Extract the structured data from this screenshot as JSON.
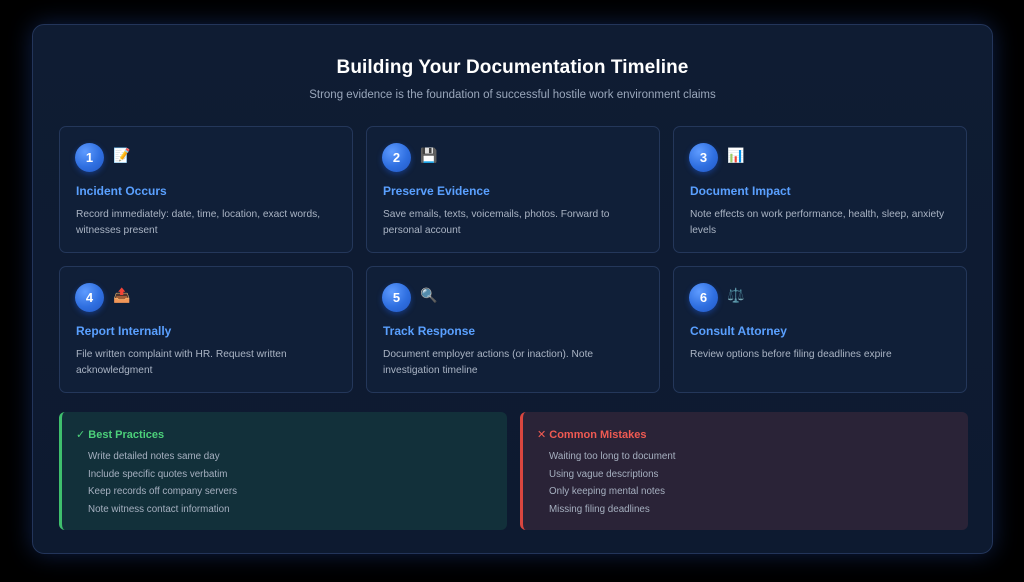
{
  "header": {
    "title": "Building Your Documentation Timeline",
    "subtitle": "Strong evidence is the foundation of successful hostile work environment claims"
  },
  "steps": [
    {
      "number": "1",
      "icon": "memo-icon",
      "glyph": "📝",
      "title": "Incident Occurs",
      "description": "Record immediately: date, time, location, exact words, witnesses present"
    },
    {
      "number": "2",
      "icon": "floppy-disk-icon",
      "glyph": "💾",
      "title": "Preserve Evidence",
      "description": "Save emails, texts, voicemails, photos. Forward to personal account"
    },
    {
      "number": "3",
      "icon": "bar-chart-icon",
      "glyph": "📊",
      "title": "Document Impact",
      "description": "Note effects on work performance, health, sleep, anxiety levels"
    },
    {
      "number": "4",
      "icon": "outbox-tray-icon",
      "glyph": "📤",
      "title": "Report Internally",
      "description": "File written complaint with HR. Request written acknowledgment"
    },
    {
      "number": "5",
      "icon": "magnifying-glass-icon",
      "glyph": "🔍",
      "title": "Track Response",
      "description": "Document employer actions (or inaction). Note investigation timeline"
    },
    {
      "number": "6",
      "icon": "balance-scale-icon",
      "glyph": "⚖️",
      "title": "Consult Attorney",
      "description": "Review options before filing deadlines expire"
    }
  ],
  "best_practices": {
    "heading": "✓ Best Practices",
    "color": "#4cd07a",
    "items": [
      "Write detailed notes same day",
      "Include specific quotes verbatim",
      "Keep records off company servers",
      "Note witness contact information"
    ]
  },
  "common_mistakes": {
    "heading": "✕ Common Mistakes",
    "color": "#ef5a52",
    "items": [
      "Waiting too long to document",
      "Using vague descriptions",
      "Only keeping mental notes",
      "Missing filing deadlines"
    ]
  }
}
